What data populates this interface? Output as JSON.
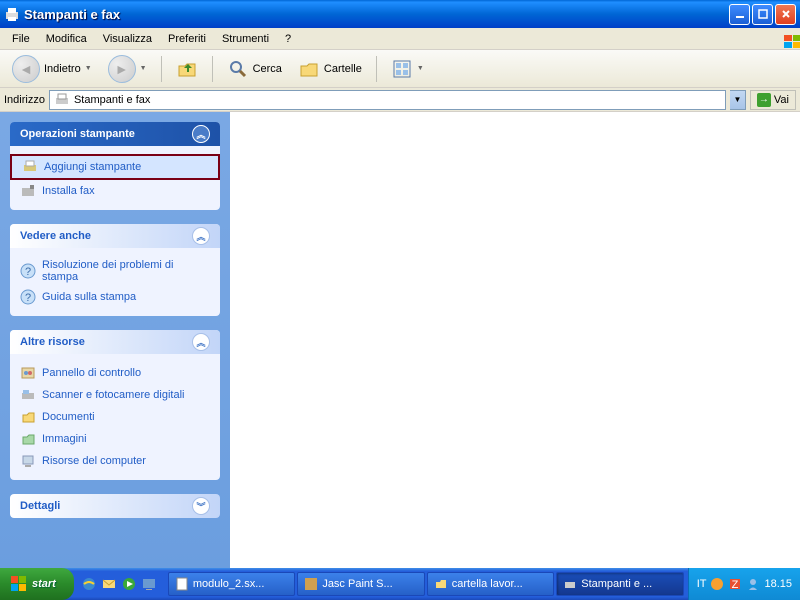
{
  "window": {
    "title": "Stampanti e fax"
  },
  "menu": {
    "file": "File",
    "edit": "Modifica",
    "view": "Visualizza",
    "favorites": "Preferiti",
    "tools": "Strumenti",
    "help": "?"
  },
  "toolbar": {
    "back": "Indietro",
    "search": "Cerca",
    "folders": "Cartelle"
  },
  "address": {
    "label": "Indirizzo",
    "value": "Stampanti e fax",
    "go": "Vai"
  },
  "panels": {
    "printer_ops": {
      "title": "Operazioni stampante",
      "items": [
        {
          "label": "Aggiungi stampante"
        },
        {
          "label": "Installa fax"
        }
      ]
    },
    "see_also": {
      "title": "Vedere anche",
      "items": [
        {
          "label": "Risoluzione dei problemi di stampa"
        },
        {
          "label": "Guida sulla stampa"
        }
      ]
    },
    "other": {
      "title": "Altre risorse",
      "items": [
        {
          "label": "Pannello di controllo"
        },
        {
          "label": "Scanner e fotocamere digitali"
        },
        {
          "label": "Documenti"
        },
        {
          "label": "Immagini"
        },
        {
          "label": "Risorse del computer"
        }
      ]
    },
    "details": {
      "title": "Dettagli"
    }
  },
  "taskbar": {
    "start": "start",
    "items": [
      {
        "label": "modulo_2.sx..."
      },
      {
        "label": "Jasc Paint S..."
      },
      {
        "label": "cartella lavor..."
      },
      {
        "label": "Stampanti e ..."
      }
    ],
    "lang": "IT",
    "time": "18.15"
  }
}
